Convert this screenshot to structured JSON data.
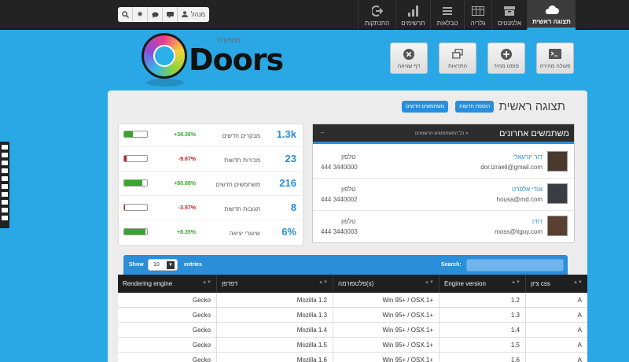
{
  "nav": [
    {
      "id": "home",
      "label": "תצוגה ראשית",
      "icon": "cloud-icon",
      "active": true
    },
    {
      "id": "elements",
      "label": "אלמנטים",
      "icon": "inbox-icon"
    },
    {
      "id": "gallery",
      "label": "גלריה",
      "icon": "gallery-icon"
    },
    {
      "id": "tables",
      "label": "טבלאות",
      "icon": "list-icon"
    },
    {
      "id": "charts",
      "label": "תרשימים",
      "icon": "bar-chart-icon"
    },
    {
      "id": "logout",
      "label": "התנתקות",
      "icon": "logout-icon"
    }
  ],
  "user": {
    "name": "מנהל"
  },
  "logo": {
    "word": "Doors",
    "small": "מהדורת"
  },
  "quick": [
    {
      "label": "פעולה מהירה",
      "icon": "terminal-icon"
    },
    {
      "label": "פוסט מהיר",
      "icon": "plus-circle-icon"
    },
    {
      "label": "התראות",
      "icon": "windows-icon"
    },
    {
      "label": "דף שגיאה",
      "icon": "close-circle-icon"
    }
  ],
  "page": {
    "title": "תצוגה ראשית",
    "btn_news": "הוספת חדשות",
    "btn_users": "משתמשים חדשים"
  },
  "stats": [
    {
      "value": "1.3k",
      "label": "מבקרים חדשים",
      "pct": "+38.36%",
      "color": "#3aa52d",
      "fill": 0.38
    },
    {
      "value": "23",
      "label": "מכירות חדשות",
      "pct": "-9.67%",
      "color": "#c02020",
      "fill": 0.1
    },
    {
      "value": "216",
      "label": "משתמשים חדשים",
      "pct": "+80.68%",
      "color": "#3aa52d",
      "fill": 0.81
    },
    {
      "value": "8",
      "label": "תגובות חדשות",
      "pct": "-3.57%",
      "color": "#c02020",
      "fill": 0.04
    },
    {
      "value": "6%",
      "label": "שיעורי יציאה",
      "pct": "+8.35%",
      "color": "#3aa52d",
      "fill": 0.92
    }
  ],
  "users_panel": {
    "title": "משתמשים אחרונים",
    "all_link": "כל המשתמשים הרשומים »",
    "phone_label": "טלפון",
    "rows": [
      {
        "name": "דור יזרעאלי",
        "email": "dor.izraeli@gmail.com",
        "phone": "444 3440000"
      },
      {
        "name": "אודי אלפרט",
        "email": "housa@md.com",
        "phone": "444 3440002"
      },
      {
        "name": "דודו",
        "email": "moss@itguy.com",
        "phone": "444 3440003"
      }
    ]
  },
  "datatable": {
    "show": "Show",
    "entries_value": "10",
    "entries": "entries",
    "search": "Search:",
    "columns": [
      "Rendering engine",
      "דפדפן",
      "פלטפורמה(s)",
      "Engine version",
      "ציון css"
    ],
    "rows": [
      [
        "Gecko",
        "Mozilla 1.2",
        "Win 95+ / OSX.1+",
        "1.2",
        "A"
      ],
      [
        "Gecko",
        "Mozilla 1.3",
        "Win 95+ / OSX.1+",
        "1.3",
        "A"
      ],
      [
        "Gecko",
        "Mozilla 1.4",
        "Win 95+ / OSX.1+",
        "1.4",
        "A"
      ],
      [
        "Gecko",
        "Mozilla 1.5",
        "Win 95+ / OSX.1+",
        "1.5",
        "A"
      ],
      [
        "Gecko",
        "Mozilla 1.6",
        "Win 95+ / OSX.1+",
        "1.6",
        "A"
      ]
    ]
  }
}
